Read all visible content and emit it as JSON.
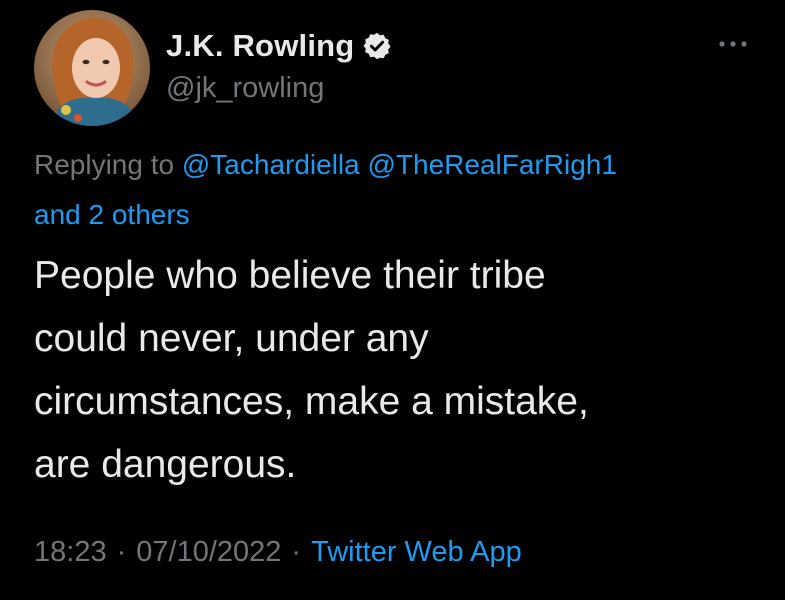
{
  "author": {
    "display_name": "J.K. Rowling",
    "handle": "@jk_rowling",
    "verified_icon": "verified-badge-icon",
    "avatar_icon": "profile-photo"
  },
  "menu": {
    "icon": "more-options-icon"
  },
  "reply": {
    "prefix": "Replying to",
    "mention_1": "@Tachardiella",
    "mention_2": "@TheRealFarRigh1",
    "others": "and 2 others"
  },
  "tweet": {
    "text": "People who believe their tribe\ncould never, under any\ncircumstances, make a mistake,\nare dangerous."
  },
  "meta": {
    "time": "18:23",
    "separator_1": "·",
    "date": "07/10/2022",
    "separator_2": "·",
    "source": "Twitter Web App"
  },
  "colors": {
    "background": "#000000",
    "primary_text": "#e7e9ea",
    "secondary_text": "#71767b",
    "link": "#1d9bf0"
  }
}
